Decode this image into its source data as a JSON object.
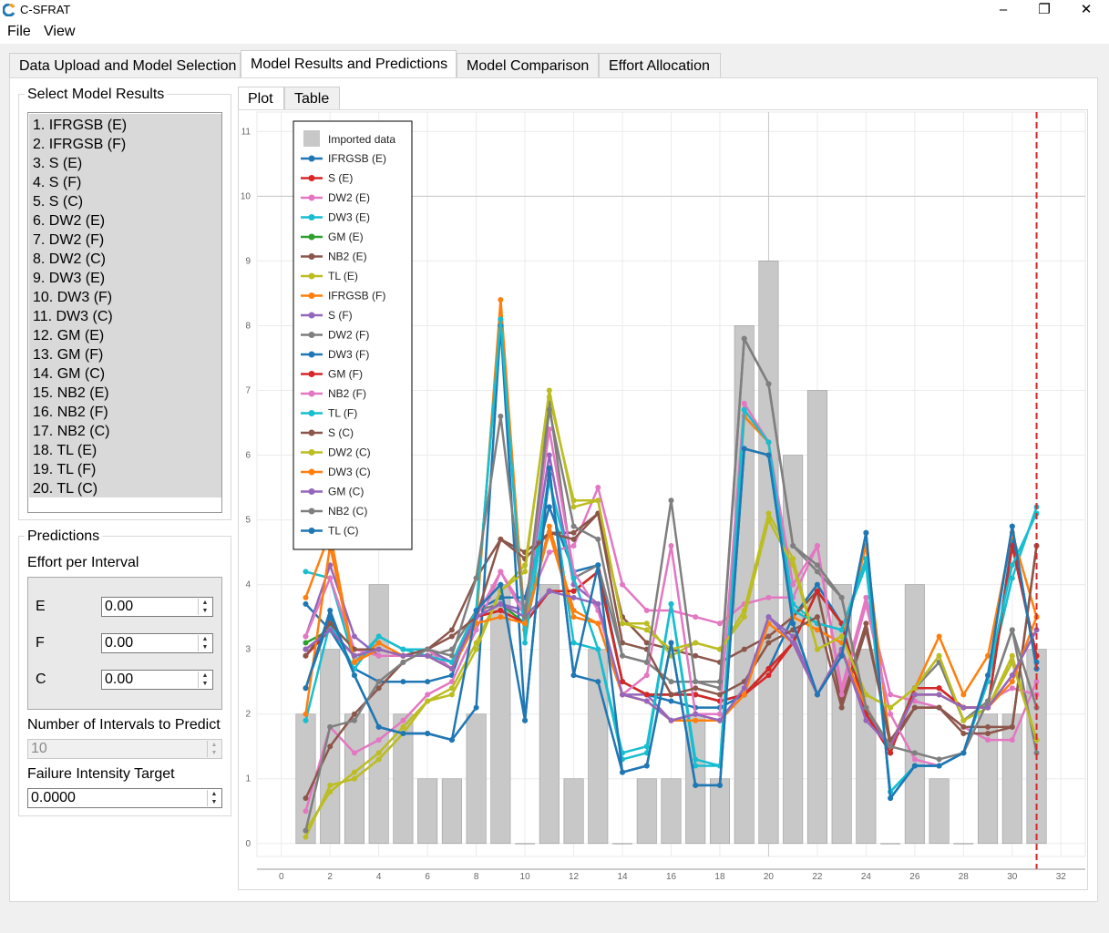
{
  "window": {
    "title": "C-SFRAT",
    "minimize": "–",
    "maximize": "❐",
    "close": "✕"
  },
  "menu": [
    "File",
    "View"
  ],
  "tabs": [
    "Data Upload and Model Selection",
    "Model Results and Predictions",
    "Model Comparison",
    "Effort Allocation"
  ],
  "active_tab": 1,
  "select_model_results": {
    "title": "Select Model Results",
    "items": [
      "1. IFRGSB (E)",
      "2. IFRGSB (F)",
      "3. S (E)",
      "4. S (F)",
      "5. S (C)",
      "6. DW2 (E)",
      "7. DW2 (F)",
      "8. DW2 (C)",
      "9. DW3 (E)",
      "10. DW3 (F)",
      "11. DW3 (C)",
      "12. GM (E)",
      "13. GM (F)",
      "14. GM (C)",
      "15. NB2 (E)",
      "16. NB2 (F)",
      "17. NB2 (C)",
      "18. TL (E)",
      "19. TL (F)",
      "20. TL (C)"
    ]
  },
  "predictions": {
    "title": "Predictions",
    "effort_label": "Effort per Interval",
    "fields": [
      {
        "label": "E",
        "value": "0.00"
      },
      {
        "label": "F",
        "value": "0.00"
      },
      {
        "label": "C",
        "value": "0.00"
      }
    ],
    "intervals_label": "Number of Intervals to Predict",
    "intervals_value": "10",
    "target_label": "Failure Intensity Target",
    "target_value": "0.0000"
  },
  "plot_tabs": [
    "Plot",
    "Table"
  ],
  "icons": {
    "app": "c-sfrat-logo-icon",
    "spin_up": "spin-up-icon",
    "spin_down": "spin-down-icon"
  },
  "chart_data": {
    "type": "bar+line",
    "title": "",
    "xlabel": "",
    "ylabel": "",
    "xlim": [
      -1,
      33
    ],
    "ylim": [
      -0.2,
      11.3
    ],
    "xticks": [
      0,
      2,
      4,
      6,
      8,
      10,
      12,
      14,
      16,
      18,
      20,
      22,
      24,
      26,
      28,
      30,
      32
    ],
    "yticks": [
      0,
      1,
      2,
      3,
      4,
      5,
      6,
      7,
      8,
      9,
      10,
      11
    ],
    "grid": true,
    "legend_position": "top-left",
    "prediction_marker_x": 31,
    "prediction_marker_color": "#d62728",
    "bar_color": "#c8c8c8",
    "imported_data": {
      "name": "Imported data",
      "x": [
        1,
        2,
        3,
        4,
        5,
        6,
        7,
        8,
        9,
        10,
        11,
        12,
        13,
        14,
        15,
        16,
        17,
        18,
        19,
        20,
        21,
        22,
        23,
        24,
        25,
        26,
        27,
        28,
        29,
        30,
        31
      ],
      "values": [
        2,
        3,
        2,
        4,
        2,
        1,
        1,
        2,
        4,
        0,
        4,
        1,
        3,
        0,
        1,
        1,
        2,
        1,
        8,
        9,
        6,
        7,
        4,
        3,
        0,
        4,
        1,
        0,
        2,
        2,
        3
      ]
    },
    "x": [
      1,
      2,
      3,
      4,
      5,
      6,
      7,
      8,
      9,
      10,
      11,
      12,
      13,
      14,
      15,
      16,
      17,
      18,
      19,
      20,
      21,
      22,
      23,
      24,
      25,
      26,
      27,
      28,
      29,
      30,
      31
    ],
    "series": [
      {
        "name": "IFRGSB (E)",
        "color": "#1f77b4",
        "values": [
          3.7,
          3.3,
          2.7,
          2.5,
          2.5,
          2.5,
          2.6,
          3.6,
          3.8,
          3.8,
          5.2,
          4.2,
          4.3,
          2.5,
          2.3,
          2.2,
          2.1,
          2.1,
          2.3,
          2.7,
          3.5,
          4.0,
          3.4,
          2.0,
          1.4,
          2.4,
          2.4,
          2.1,
          2.1,
          4.7,
          2.8
        ]
      },
      {
        "name": "S (E)",
        "color": "#d62728",
        "values": [
          2.9,
          3.3,
          2.9,
          3.0,
          2.9,
          2.9,
          2.7,
          3.5,
          3.6,
          3.4,
          3.9,
          3.9,
          4.2,
          2.5,
          2.3,
          2.3,
          2.3,
          2.2,
          2.3,
          2.6,
          3.1,
          3.9,
          3.4,
          2.0,
          1.4,
          2.4,
          2.4,
          2.1,
          2.1,
          4.6,
          2.9
        ]
      },
      {
        "name": "DW2 (E)",
        "color": "#e377c2",
        "values": [
          0.5,
          1.8,
          1.4,
          1.6,
          1.9,
          2.3,
          2.5,
          3.3,
          4.2,
          3.6,
          4.5,
          4.6,
          5.5,
          4.0,
          3.6,
          3.6,
          3.5,
          3.4,
          3.7,
          3.8,
          3.8,
          4.6,
          2.4,
          3.8,
          2.3,
          2.2,
          2.1,
          1.8,
          1.6,
          1.6,
          2.5
        ]
      },
      {
        "name": "DW3 (E)",
        "color": "#17becf",
        "values": [
          4.2,
          4.1,
          2.8,
          3.2,
          3.0,
          3.0,
          2.8,
          3.6,
          8.1,
          3.4,
          5.7,
          3.1,
          3.0,
          1.3,
          1.4,
          3.7,
          1.2,
          1.2,
          6.6,
          6.2,
          3.7,
          3.4,
          3.3,
          4.3,
          0.8,
          1.2,
          1.2,
          1.4,
          2.5,
          4.1,
          5.2
        ]
      },
      {
        "name": "GM (E)",
        "color": "#2ca02c",
        "values": [
          3.1,
          3.3,
          2.9,
          3.0,
          2.9,
          2.9,
          2.7,
          3.5,
          3.7,
          3.4,
          3.9,
          3.9,
          4.2,
          2.5,
          2.3,
          2.3,
          2.3,
          2.2,
          2.3,
          2.7,
          3.1,
          3.9,
          3.4,
          2.1,
          1.4,
          2.4,
          2.4,
          2.1,
          2.1,
          4.6,
          2.9
        ]
      },
      {
        "name": "NB2 (E)",
        "color": "#8c564b",
        "values": [
          0.7,
          1.5,
          2.0,
          2.4,
          2.8,
          3.0,
          3.3,
          4.1,
          4.7,
          4.5,
          4.8,
          4.8,
          5.1,
          3.5,
          3.1,
          3.0,
          2.9,
          2.8,
          3.0,
          3.2,
          3.5,
          3.9,
          2.2,
          3.4,
          1.5,
          2.1,
          2.1,
          1.7,
          1.7,
          1.8,
          4.6
        ]
      },
      {
        "name": "TL (E)",
        "color": "#bcbd22",
        "values": [
          0.2,
          0.8,
          1.1,
          1.4,
          1.8,
          2.2,
          2.4,
          3.1,
          3.9,
          4.3,
          6.9,
          5.3,
          5.3,
          3.4,
          3.4,
          2.9,
          3.1,
          3.0,
          3.6,
          5.1,
          4.4,
          3.0,
          3.2,
          2.3,
          2.1,
          2.4,
          2.9,
          1.9,
          2.1,
          2.9,
          1.6
        ]
      },
      {
        "name": "IFRGSB (F)",
        "color": "#ff7f0e",
        "values": [
          3.8,
          4.8,
          2.8,
          3.1,
          2.9,
          2.9,
          2.7,
          3.4,
          8.4,
          3.3,
          4.9,
          3.6,
          3.4,
          2.3,
          2.2,
          1.9,
          2.0,
          2.0,
          6.6,
          6.2,
          3.5,
          3.3,
          3.1,
          4.6,
          1.5,
          2.4,
          3.2,
          2.3,
          2.9,
          4.8,
          3.5
        ]
      },
      {
        "name": "S (F)",
        "color": "#9467bd",
        "values": [
          3.2,
          4.3,
          3.2,
          2.9,
          2.9,
          3.0,
          2.8,
          3.5,
          3.7,
          3.6,
          6.0,
          4.0,
          3.7,
          2.3,
          2.3,
          1.9,
          2.0,
          1.9,
          2.3,
          3.5,
          3.2,
          2.3,
          3.0,
          2.0,
          1.5,
          2.3,
          2.3,
          2.1,
          2.1,
          2.6,
          3.3
        ]
      },
      {
        "name": "DW2 (F)",
        "color": "#7f7f7f",
        "values": [
          3.0,
          3.3,
          2.9,
          3.0,
          2.9,
          2.9,
          3.0,
          3.6,
          3.7,
          3.5,
          6.8,
          4.1,
          4.3,
          2.9,
          2.8,
          2.5,
          2.5,
          2.4,
          7.8,
          7.1,
          4.6,
          4.2,
          3.8,
          2.1,
          1.5,
          2.4,
          2.8,
          1.9,
          2.2,
          3.3,
          1.4
        ]
      },
      {
        "name": "DW3 (F)",
        "color": "#1f77b4",
        "values": [
          2.4,
          3.5,
          2.6,
          1.8,
          1.7,
          1.7,
          1.6,
          2.1,
          8.0,
          1.9,
          5.8,
          2.6,
          2.5,
          1.1,
          1.2,
          3.1,
          0.9,
          0.9,
          6.1,
          6.0,
          3.4,
          2.3,
          2.9,
          4.8,
          0.7,
          1.2,
          1.2,
          1.4,
          2.6,
          4.9,
          2.7
        ]
      },
      {
        "name": "GM (F)",
        "color": "#d62728",
        "values": [
          3.0,
          3.3,
          2.9,
          3.0,
          2.9,
          2.9,
          2.7,
          3.5,
          3.6,
          3.4,
          3.9,
          3.9,
          4.2,
          2.5,
          2.3,
          2.3,
          2.3,
          2.2,
          2.3,
          2.7,
          3.1,
          3.9,
          3.4,
          2.0,
          1.4,
          2.4,
          2.4,
          2.1,
          2.1,
          4.6,
          2.9
        ]
      },
      {
        "name": "NB2 (F)",
        "color": "#e377c2",
        "values": [
          3.2,
          4.1,
          3.0,
          2.9,
          2.9,
          3.0,
          2.7,
          3.5,
          4.2,
          3.5,
          6.4,
          4.2,
          3.6,
          2.3,
          2.6,
          4.6,
          2.0,
          2.0,
          6.8,
          6.2,
          4.0,
          4.6,
          2.3,
          3.7,
          2.0,
          1.3,
          1.2,
          1.4,
          2.2,
          2.4,
          2.3
        ]
      },
      {
        "name": "TL (F)",
        "color": "#17becf",
        "values": [
          1.9,
          3.4,
          2.7,
          3.2,
          3.0,
          2.9,
          2.8,
          3.6,
          8.1,
          3.1,
          5.6,
          4.1,
          3.0,
          1.4,
          1.5,
          3.7,
          1.3,
          1.2,
          6.7,
          6.2,
          3.6,
          3.4,
          3.3,
          4.4,
          0.8,
          1.2,
          1.2,
          1.4,
          2.6,
          4.3,
          5.1
        ]
      },
      {
        "name": "S (C)",
        "color": "#8c564b",
        "values": [
          2.9,
          3.4,
          3.0,
          3.0,
          2.9,
          3.0,
          3.2,
          3.5,
          4.7,
          4.4,
          4.8,
          4.7,
          5.1,
          3.1,
          3.0,
          2.3,
          2.4,
          2.3,
          2.5,
          3.1,
          3.3,
          3.5,
          2.1,
          3.3,
          1.6,
          2.1,
          2.1,
          1.8,
          1.8,
          1.8,
          4.6
        ]
      },
      {
        "name": "DW2 (C)",
        "color": "#bcbd22",
        "values": [
          0.1,
          0.9,
          1.0,
          1.3,
          1.7,
          2.2,
          2.3,
          3.0,
          3.9,
          4.2,
          7.0,
          5.2,
          5.3,
          3.4,
          3.3,
          3.0,
          3.1,
          3.0,
          3.5,
          5.0,
          4.3,
          3.0,
          3.2,
          2.3,
          2.1,
          2.4,
          2.9,
          1.9,
          2.1,
          2.8,
          1.6
        ]
      },
      {
        "name": "DW3 (C)",
        "color": "#ff7f0e",
        "values": [
          2.0,
          4.6,
          2.8,
          3.0,
          2.9,
          2.9,
          2.7,
          3.4,
          3.5,
          3.4,
          4.8,
          3.5,
          3.4,
          2.3,
          2.2,
          1.9,
          1.9,
          1.9,
          2.3,
          3.4,
          3.1,
          2.3,
          3.0,
          2.1,
          1.5,
          2.3,
          2.3,
          2.1,
          2.1,
          2.5,
          3.5
        ]
      },
      {
        "name": "GM (C)",
        "color": "#9467bd",
        "values": [
          3.0,
          3.3,
          2.9,
          3.0,
          2.9,
          2.9,
          2.7,
          3.5,
          3.7,
          3.5,
          3.9,
          3.8,
          3.7,
          2.3,
          2.2,
          1.9,
          2.0,
          1.9,
          2.4,
          3.5,
          3.1,
          2.3,
          3.0,
          1.9,
          1.5,
          2.3,
          2.3,
          2.1,
          2.1,
          2.6,
          3.3
        ]
      },
      {
        "name": "NB2 (C)",
        "color": "#7f7f7f",
        "values": [
          0.2,
          1.8,
          1.9,
          2.5,
          2.8,
          3.0,
          2.9,
          4.1,
          6.6,
          3.5,
          6.7,
          4.9,
          4.7,
          2.9,
          2.8,
          5.3,
          2.5,
          2.5,
          7.8,
          7.1,
          4.6,
          4.3,
          3.8,
          2.1,
          1.5,
          1.4,
          1.3,
          1.4,
          2.2,
          3.3,
          2.1
        ]
      },
      {
        "name": "TL (C)",
        "color": "#1f77b4",
        "values": [
          2.4,
          3.6,
          2.6,
          1.8,
          1.7,
          1.7,
          1.6,
          3.6,
          4.0,
          1.9,
          5.8,
          2.6,
          4.3,
          1.1,
          1.2,
          3.1,
          0.9,
          0.9,
          6.1,
          6.0,
          3.4,
          2.3,
          2.9,
          4.8,
          0.7,
          1.2,
          1.2,
          1.4,
          2.6,
          4.9,
          2.7
        ]
      }
    ]
  }
}
